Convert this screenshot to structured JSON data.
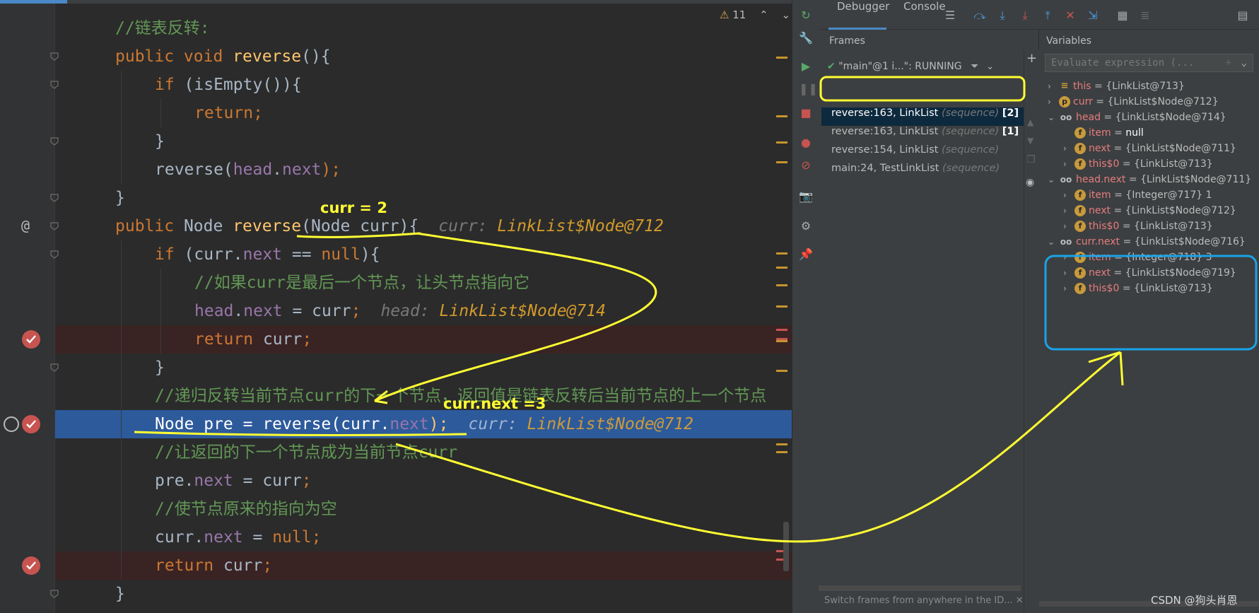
{
  "editor": {
    "warning_count": "11",
    "lines": [
      {
        "n": 1,
        "indent": 1,
        "kind": "comment",
        "parts": [
          [
            "cm",
            "//链表反转:"
          ]
        ]
      },
      {
        "n": 2,
        "indent": 1,
        "kind": "normal",
        "parts": [
          [
            "kw",
            "public void "
          ],
          [
            "fn",
            "reverse"
          ],
          [
            "tp",
            "(){"
          ]
        ]
      },
      {
        "n": 3,
        "indent": 2,
        "kind": "normal",
        "parts": [
          [
            "kw",
            "if "
          ],
          [
            "tp",
            "(isEmpty()){"
          ]
        ]
      },
      {
        "n": 4,
        "indent": 3,
        "kind": "normal",
        "parts": [
          [
            "kw",
            "return;"
          ]
        ]
      },
      {
        "n": 5,
        "indent": 2,
        "kind": "normal",
        "parts": [
          [
            "tp",
            "}"
          ]
        ]
      },
      {
        "n": 6,
        "indent": 2,
        "kind": "normal",
        "parts": [
          [
            "tp",
            "reverse("
          ],
          [
            "fld",
            "head"
          ],
          [
            "tp",
            "."
          ],
          [
            "fld",
            "next"
          ],
          [
            "kw",
            ");"
          ]
        ]
      },
      {
        "n": 7,
        "indent": 1,
        "kind": "normal",
        "parts": [
          [
            "tp",
            "}"
          ]
        ]
      },
      {
        "n": 8,
        "indent": 1,
        "kind": "normal",
        "parts": [
          [
            "kw",
            "public "
          ],
          [
            "tp",
            "Node "
          ],
          [
            "fn",
            "reverse"
          ],
          [
            "tp",
            "(Node curr){"
          ]
        ],
        "hint": {
          "label": "curr: ",
          "value": "LinkList$Node@712"
        }
      },
      {
        "n": 9,
        "indent": 2,
        "kind": "normal",
        "parts": [
          [
            "kw",
            "if "
          ],
          [
            "tp",
            "(curr."
          ],
          [
            "fld",
            "next"
          ],
          [
            "tp",
            " == "
          ],
          [
            "kw",
            "null"
          ],
          [
            "tp",
            "){"
          ]
        ]
      },
      {
        "n": 10,
        "indent": 3,
        "kind": "comment",
        "parts": [
          [
            "cm",
            "//如果curr是最后一个节点，让头节点指向它"
          ]
        ]
      },
      {
        "n": 11,
        "indent": 3,
        "kind": "normal",
        "parts": [
          [
            "fld",
            "head"
          ],
          [
            "tp",
            "."
          ],
          [
            "fld",
            "next"
          ],
          [
            "tp",
            " = curr"
          ],
          [
            "kw",
            ";"
          ]
        ],
        "hint": {
          "label": "head: ",
          "value": "LinkList$Node@714"
        }
      },
      {
        "n": 12,
        "indent": 3,
        "kind": "bp",
        "parts": [
          [
            "kw",
            "return "
          ],
          [
            "tp",
            "curr"
          ],
          [
            "kw",
            ";"
          ]
        ]
      },
      {
        "n": 13,
        "indent": 2,
        "kind": "normal",
        "parts": [
          [
            "tp",
            "}"
          ]
        ]
      },
      {
        "n": 14,
        "indent": 2,
        "kind": "comment",
        "parts": [
          [
            "cm",
            "//递归反转当前节点curr的下一个节点，返回值是链表反转后当前节点的上一个节点"
          ]
        ]
      },
      {
        "n": 15,
        "indent": 2,
        "kind": "cur",
        "parts": [
          [
            "tp",
            "Node pre = "
          ],
          [
            "fn",
            "reverse"
          ],
          [
            "tp",
            "(curr."
          ],
          [
            "fld",
            "next"
          ],
          [
            "kw",
            ");"
          ]
        ],
        "hint": {
          "label": "curr: ",
          "value": "LinkList$Node@712"
        }
      },
      {
        "n": 16,
        "indent": 2,
        "kind": "comment",
        "parts": [
          [
            "cm",
            "//让返回的下一个节点成为当前节点curr"
          ]
        ]
      },
      {
        "n": 17,
        "indent": 2,
        "kind": "normal",
        "parts": [
          [
            "tp",
            "pre."
          ],
          [
            "fld",
            "next"
          ],
          [
            "tp",
            " = curr"
          ],
          [
            "kw",
            ";"
          ]
        ]
      },
      {
        "n": 18,
        "indent": 2,
        "kind": "comment",
        "parts": [
          [
            "cm",
            "//使节点原来的指向为空"
          ]
        ]
      },
      {
        "n": 19,
        "indent": 2,
        "kind": "normal",
        "parts": [
          [
            "tp",
            "curr."
          ],
          [
            "fld",
            "next"
          ],
          [
            "tp",
            " = "
          ],
          [
            "kw",
            "null;"
          ]
        ]
      },
      {
        "n": 20,
        "indent": 2,
        "kind": "bp",
        "parts": [
          [
            "kw",
            "return "
          ],
          [
            "tp",
            "curr"
          ],
          [
            "kw",
            ";"
          ]
        ]
      },
      {
        "n": 21,
        "indent": 1,
        "kind": "normal",
        "parts": [
          [
            "tp",
            "}"
          ]
        ]
      }
    ]
  },
  "debugger": {
    "tabs": [
      "Debugger",
      "Console"
    ],
    "frames_title": "Frames",
    "variables_title": "Variables",
    "thread_label": "\"main\"@1 i...\": RUNNING",
    "frames": [
      {
        "method": "reverse:163, LinkList",
        "seq": "(sequence)",
        "num": "[2]"
      },
      {
        "method": "reverse:163, LinkList",
        "seq": "(sequence)",
        "num": "[1]"
      },
      {
        "method": "reverse:154, LinkList",
        "seq": "(sequence)",
        "num": ""
      },
      {
        "method": "main:24, TestLinkList",
        "seq": "(sequence)",
        "num": ""
      }
    ],
    "frames_hint": "Switch frames from anywhere in the ID...",
    "eval_placeholder": "Evaluate expression (...",
    "variables": [
      {
        "depth": 0,
        "chev": "›",
        "badge": "≡",
        "badge_kind": "list",
        "name": "this",
        "value": "{LinkList@713}",
        "null": false
      },
      {
        "depth": 0,
        "chev": "›",
        "badge": "p",
        "badge_kind": "p",
        "name": "curr",
        "value": "{LinkList$Node@712}",
        "null": false
      },
      {
        "depth": 0,
        "chev": "⌄",
        "badge": "oo",
        "badge_kind": "glasses",
        "name": "head",
        "value": "{LinkList$Node@714}",
        "null": false
      },
      {
        "depth": 1,
        "chev": "",
        "badge": "f",
        "badge_kind": "f",
        "name": "item",
        "value": "null",
        "null": true
      },
      {
        "depth": 1,
        "chev": "›",
        "badge": "f",
        "badge_kind": "f",
        "name": "next",
        "value": "{LinkList$Node@711}",
        "null": false
      },
      {
        "depth": 1,
        "chev": "›",
        "badge": "f",
        "badge_kind": "f",
        "name": "this$0",
        "value": "{LinkList@713}",
        "null": false
      },
      {
        "depth": 0,
        "chev": "⌄",
        "badge": "oo",
        "badge_kind": "glasses",
        "name": "head.next",
        "value": "{LinkList$Node@711}",
        "null": false
      },
      {
        "depth": 1,
        "chev": "›",
        "badge": "f",
        "badge_kind": "f",
        "name": "item",
        "value": "{Integer@717} 1",
        "null": false
      },
      {
        "depth": 1,
        "chev": "›",
        "badge": "f",
        "badge_kind": "f",
        "name": "next",
        "value": "{LinkList$Node@712}",
        "null": false
      },
      {
        "depth": 1,
        "chev": "›",
        "badge": "f",
        "badge_kind": "f",
        "name": "this$0",
        "value": "{LinkList@713}",
        "null": false
      },
      {
        "depth": 0,
        "chev": "⌄",
        "badge": "oo",
        "badge_kind": "glasses",
        "name": "curr.next",
        "value": "{LinkList$Node@716}",
        "null": false
      },
      {
        "depth": 1,
        "chev": "›",
        "badge": "f",
        "badge_kind": "f",
        "name": "item",
        "value": "{Integer@718} 3",
        "null": false
      },
      {
        "depth": 1,
        "chev": "›",
        "badge": "f",
        "badge_kind": "f",
        "name": "next",
        "value": "{LinkList$Node@719}",
        "null": false
      },
      {
        "depth": 1,
        "chev": "›",
        "badge": "f",
        "badge_kind": "f",
        "name": "this$0",
        "value": "{LinkList@713}",
        "null": false
      }
    ]
  },
  "annotations": {
    "curr_label": "curr = 2",
    "currnext_label": "curr.next  =3",
    "highlight_color": "#ffff33",
    "box_color": "#1aa3e8"
  },
  "watermark": "CSDN @狗头肖恩"
}
